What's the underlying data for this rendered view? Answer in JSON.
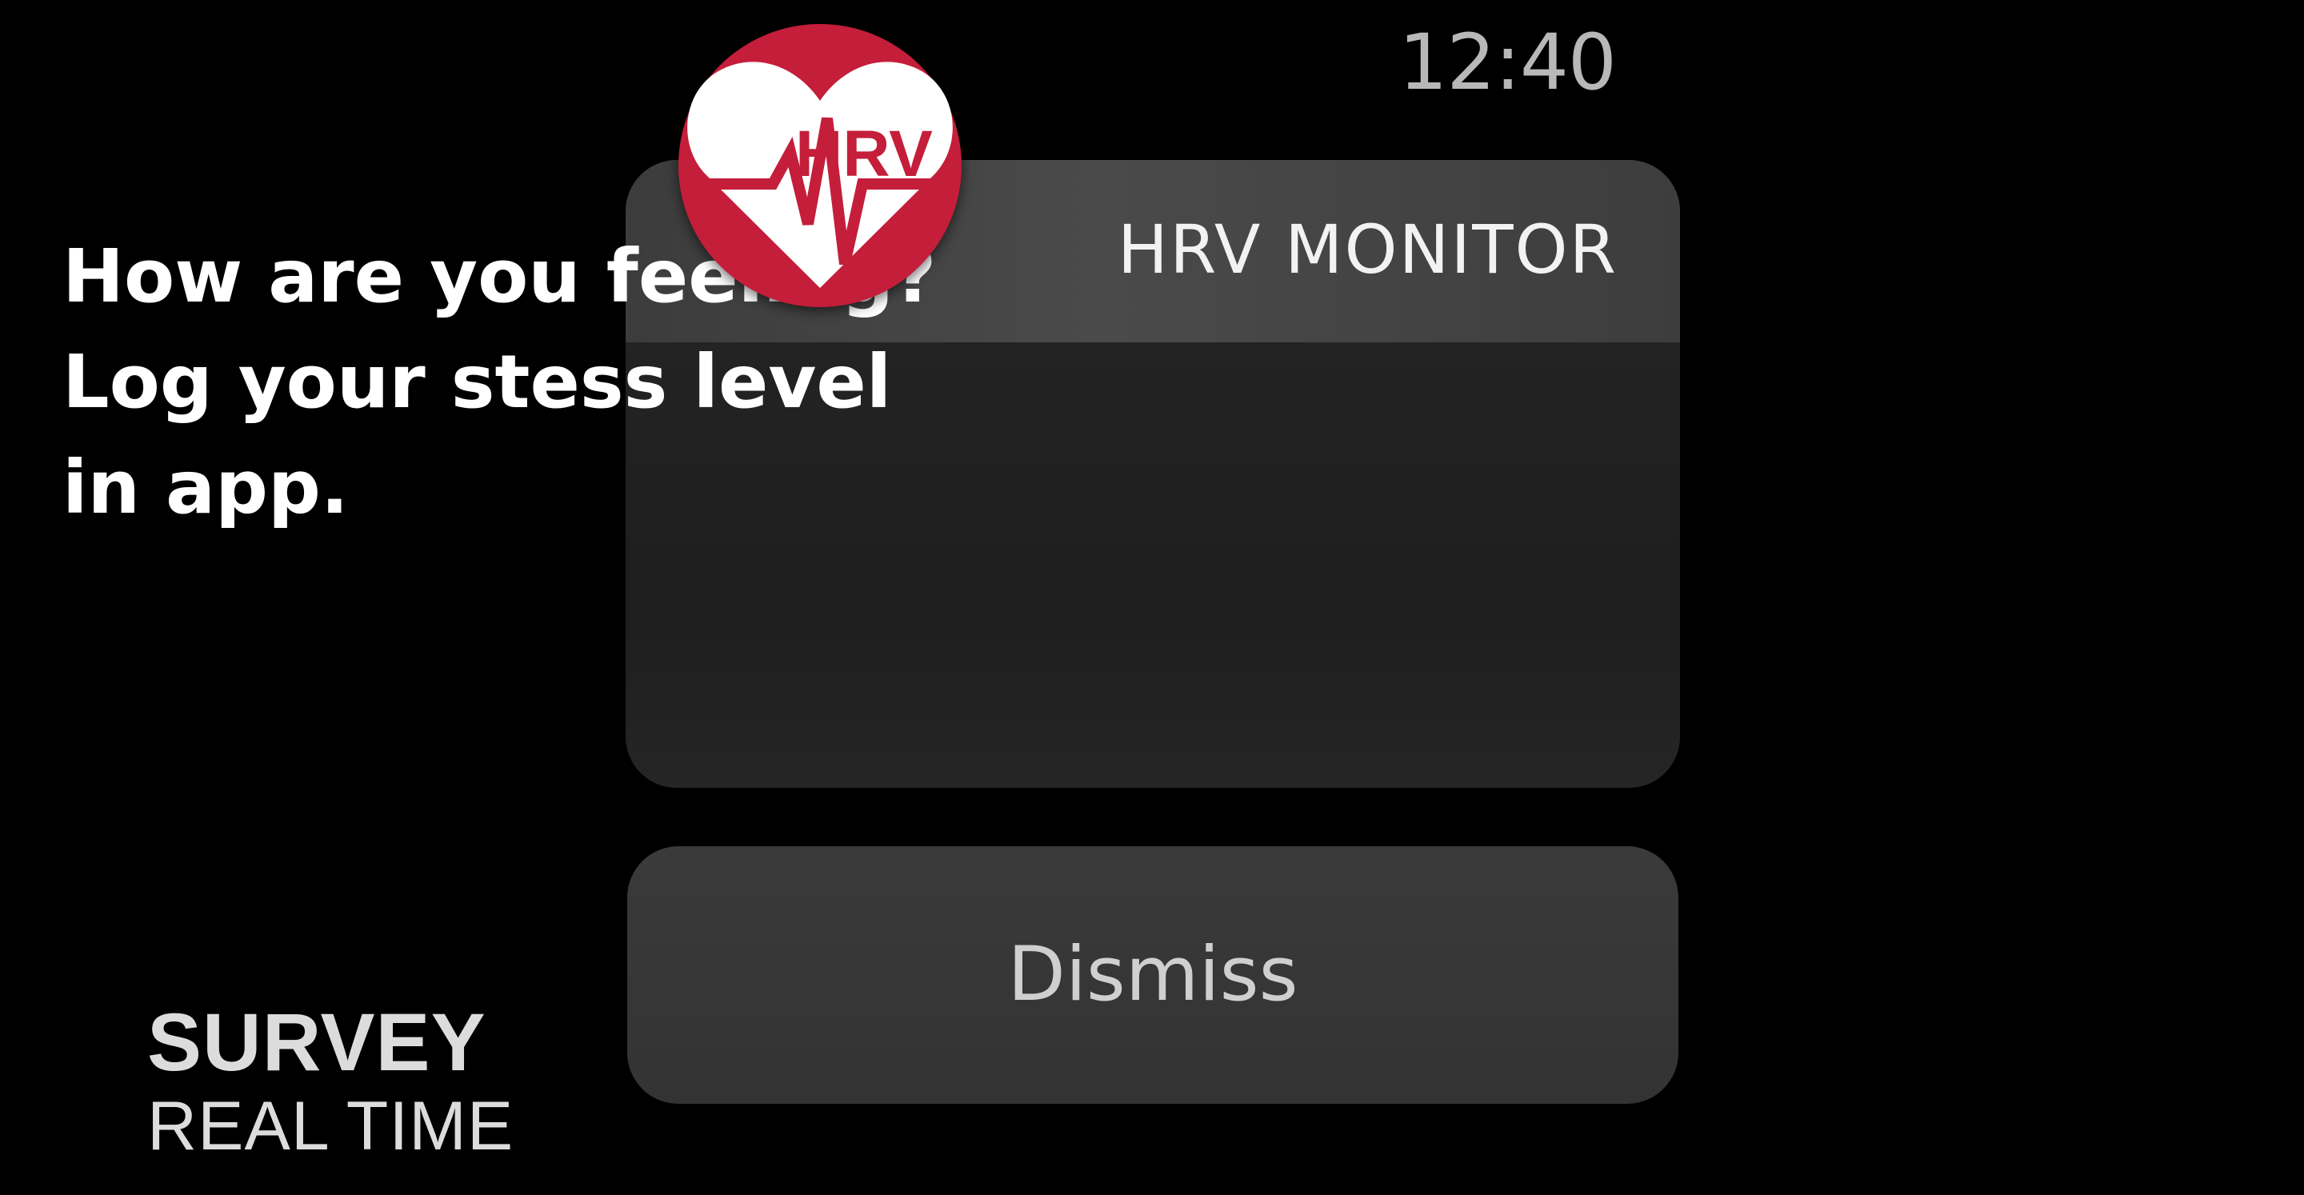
{
  "status_bar": {
    "time": "12:40"
  },
  "notification": {
    "app_name": "HRV MONITOR",
    "app_icon": {
      "name": "hrv-heart-icon",
      "label": "HRV",
      "color": "#c41e3a"
    },
    "message_lines": [
      "How are you feeling?",
      "Log your stess level",
      "in app."
    ]
  },
  "actions": {
    "dismiss_label": "Dismiss"
  },
  "caption": {
    "title": "SURVEY",
    "subtitle": "REAL TIME"
  }
}
